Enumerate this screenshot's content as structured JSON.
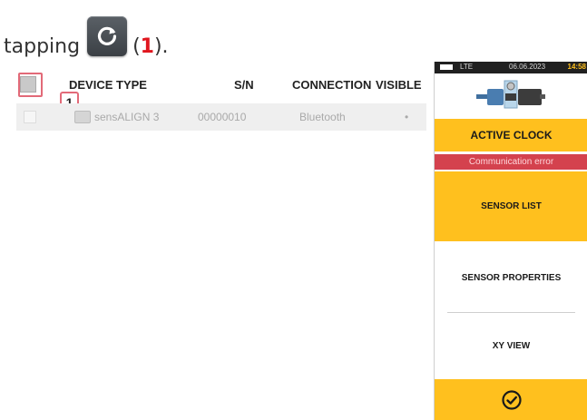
{
  "intro": {
    "prefix": "tapping",
    "open_paren": "(",
    "callout_number": "1",
    "close_paren": ")."
  },
  "table": {
    "callout_label": "1",
    "columns": {
      "device_type": "DEVICE TYPE",
      "serial": "S/N",
      "connection": "CONNECTION",
      "visible": "VISIBLE"
    },
    "rows": [
      {
        "device_type": "sensALIGN 3",
        "serial": "00000010",
        "connection": "Bluetooth",
        "visible": "•"
      }
    ]
  },
  "panel": {
    "status": {
      "signal": "LTE",
      "date": "06.06.2023",
      "time": "14:58"
    },
    "active_clock": "ACTIVE CLOCK",
    "error": "Communication error",
    "sensor_list": "SENSOR LIST",
    "sensor_properties": "SENSOR PROPERTIES",
    "xy_view": "XY VIEW"
  },
  "colors": {
    "accent_yellow": "#ffc01e",
    "error_red": "#d4424e",
    "callout_red": "#e0161e",
    "highlight_pink": "#e26a78"
  },
  "icons": [
    "refresh-icon",
    "sensor-icon",
    "machine-train-icon",
    "checkmark-circle-icon"
  ]
}
